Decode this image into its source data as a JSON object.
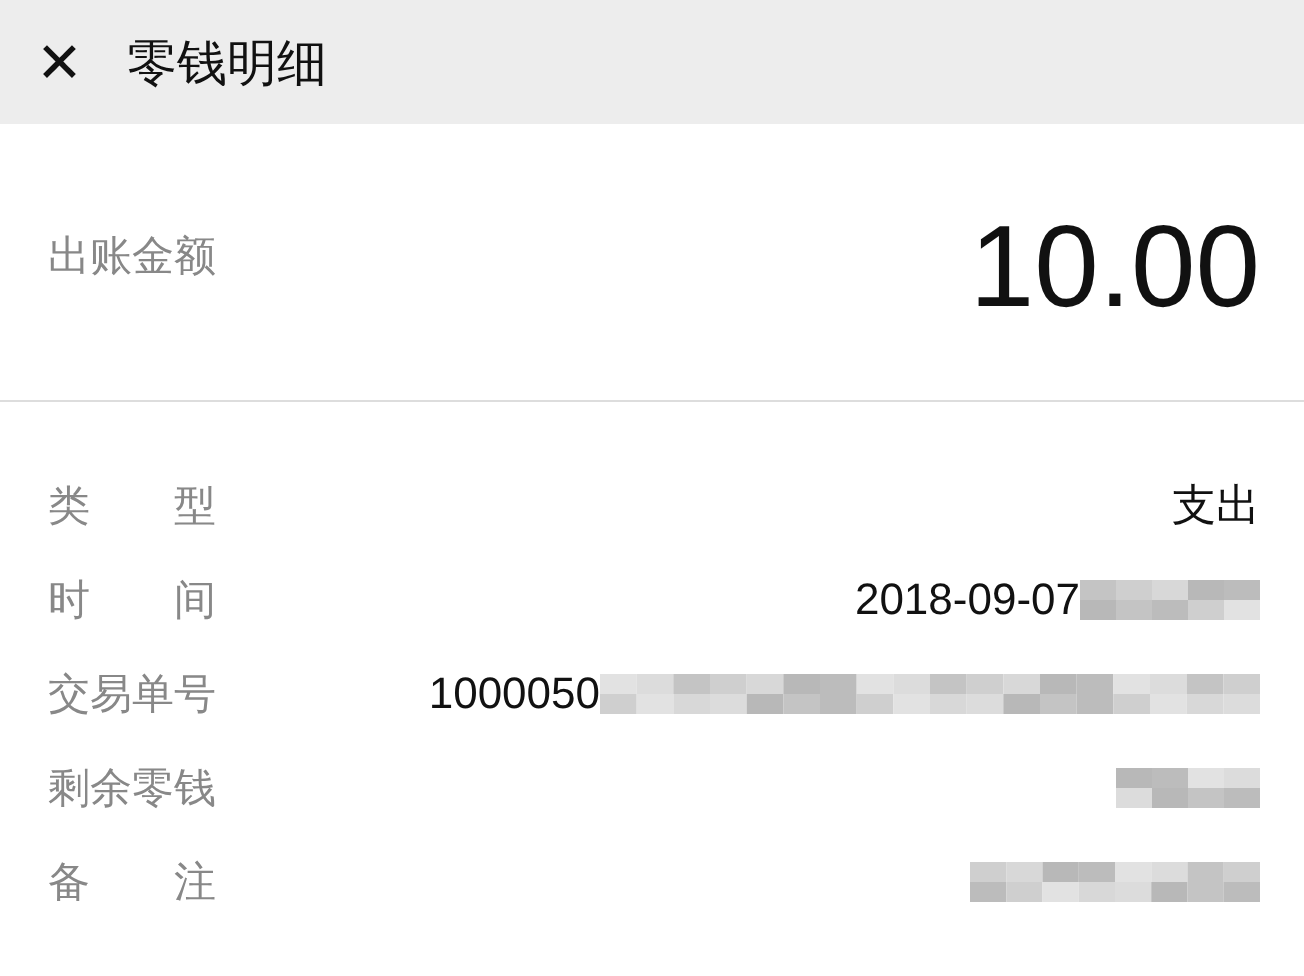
{
  "header": {
    "close": "✕",
    "title": "零钱明细"
  },
  "amount": {
    "label": "出账金额",
    "value": "10.00"
  },
  "details": [
    {
      "label": "类　　型",
      "value": "支出",
      "redacted": false
    },
    {
      "label": "时　　间",
      "value": "2018-09-07",
      "redacted": true
    },
    {
      "label": "交易单号",
      "value": "1000050",
      "redacted": true
    },
    {
      "label": "剩余零钱",
      "redacted": true
    },
    {
      "label": "备　　注",
      "redacted": true
    }
  ]
}
